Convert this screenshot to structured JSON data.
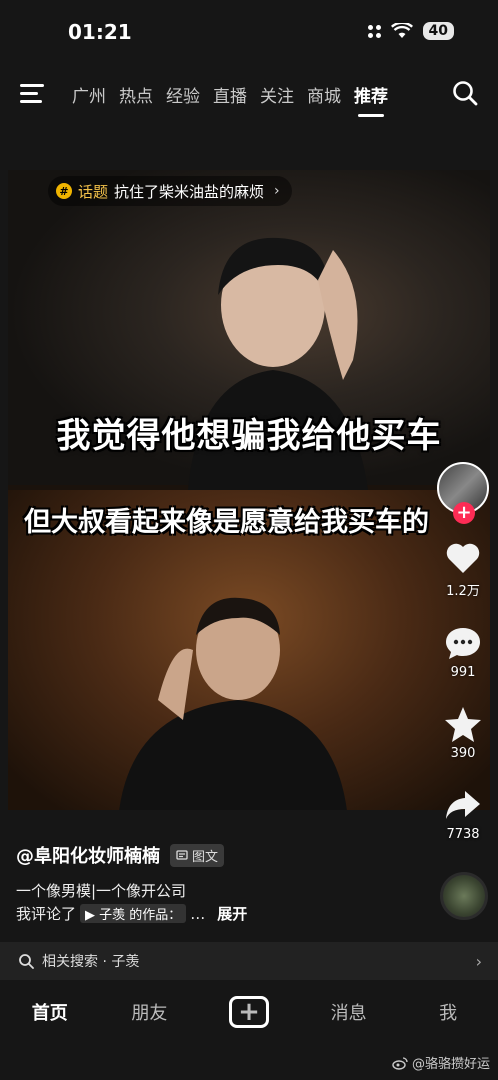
{
  "status_bar": {
    "time": "01:21",
    "battery": "40"
  },
  "nav": {
    "tabs": [
      {
        "label": "广州"
      },
      {
        "label": "热点"
      },
      {
        "label": "经验"
      },
      {
        "label": "直播"
      },
      {
        "label": "关注"
      },
      {
        "label": "商城"
      },
      {
        "label": "推荐",
        "active": true
      }
    ]
  },
  "video": {
    "hashtag_label": "话题",
    "hashtag_topic": "抗住了柴米油盐的麻烦",
    "caption_top": "我觉得他想骗我给他买车",
    "caption_bottom": "但大叔看起来像是愿意给我买车的"
  },
  "actions": {
    "likes": "1.2万",
    "comments": "991",
    "favorites": "390",
    "shares": "7738"
  },
  "info": {
    "author": "@阜阳化妆师楠楠",
    "type_badge": "图文",
    "description": "一个像男模|一个像开公司",
    "comment_prefix": "我评论了",
    "mention": "▶ 子羡 的作品：",
    "comment_suffix": "…",
    "expand": "展开"
  },
  "related": {
    "label": "相关搜索 · 子羡"
  },
  "tabbar": {
    "home": "首页",
    "friends": "朋友",
    "messages": "消息",
    "me": "我"
  },
  "watermark": "@骆骆攒好运",
  "colors": {
    "accent": "#fe2c55",
    "hashtag": "#f4c24a"
  }
}
